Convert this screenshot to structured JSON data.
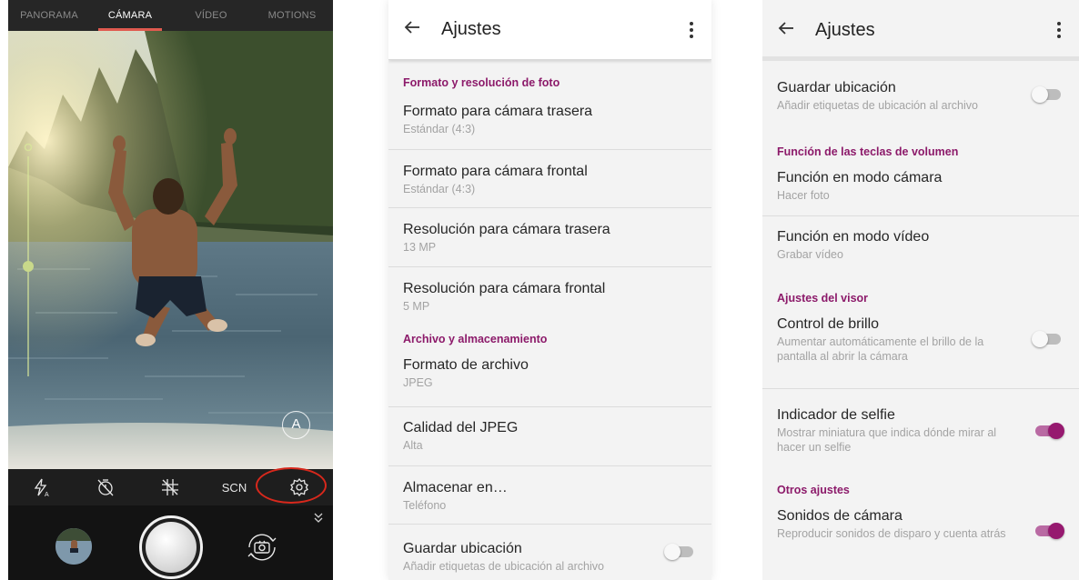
{
  "camera": {
    "modes": [
      {
        "label": "PANORAMA",
        "active": false
      },
      {
        "label": "CÁMARA",
        "active": true
      },
      {
        "label": "VÍDEO",
        "active": false
      },
      {
        "label": "MOTIONS",
        "active": false
      }
    ],
    "auto_label": "A",
    "toolbar": {
      "icons": [
        "flash-auto-icon",
        "timer-off-icon",
        "grid-off-icon",
        "scene-mode",
        "settings-gear-icon"
      ],
      "scene_label": "SCN"
    },
    "colors": {
      "highlight_ring": "#d8281c",
      "active_mode_underline": "#e05a4f"
    }
  },
  "settings_left": {
    "title": "Ajustes",
    "sections": [
      {
        "header": "Formato y resolución de foto",
        "items": [
          {
            "title": "Formato para cámara trasera",
            "subtitle": "Estándar (4:3)"
          },
          {
            "title": "Formato para cámara frontal",
            "subtitle": "Estándar (4:3)"
          },
          {
            "title": "Resolución para cámara trasera",
            "subtitle": "13 MP"
          },
          {
            "title": "Resolución para cámara frontal",
            "subtitle": "5 MP"
          }
        ]
      },
      {
        "header": "Archivo y almacenamiento",
        "items": [
          {
            "title": "Formato de archivo",
            "subtitle": "JPEG"
          },
          {
            "title": "Calidad del JPEG",
            "subtitle": "Alta"
          },
          {
            "title": "Almacenar en…",
            "subtitle": "Teléfono"
          },
          {
            "title": "Guardar ubicación",
            "subtitle": "Añadir etiquetas de ubicación al archivo",
            "toggle": false
          }
        ]
      }
    ]
  },
  "settings_right": {
    "title": "Ajustes",
    "top_item": {
      "title": "Guardar ubicación",
      "subtitle": "Añadir etiquetas de ubicación al archivo",
      "toggle": false
    },
    "sections": [
      {
        "header": "Función de las teclas de volumen",
        "items": [
          {
            "title": "Función en modo cámara",
            "subtitle": "Hacer foto"
          },
          {
            "title": "Función en modo vídeo",
            "subtitle": "Grabar vídeo"
          }
        ]
      },
      {
        "header": "Ajustes del visor",
        "items": [
          {
            "title": "Control de brillo",
            "subtitle": "Aumentar automáticamente el brillo de la pantalla al abrir la cámara",
            "toggle": false
          },
          {
            "title": "Indicador de selfie",
            "subtitle": "Mostrar miniatura que indica dónde mirar al hacer un selfie",
            "toggle": true
          }
        ]
      },
      {
        "header": "Otros ajustes",
        "items": [
          {
            "title": "Sonidos de cámara",
            "subtitle": "Reproducir sonidos de disparo y cuenta atrás",
            "toggle": true
          }
        ]
      }
    ],
    "colors": {
      "accent": "#96196f",
      "section_header": "#8c1a6a"
    }
  }
}
